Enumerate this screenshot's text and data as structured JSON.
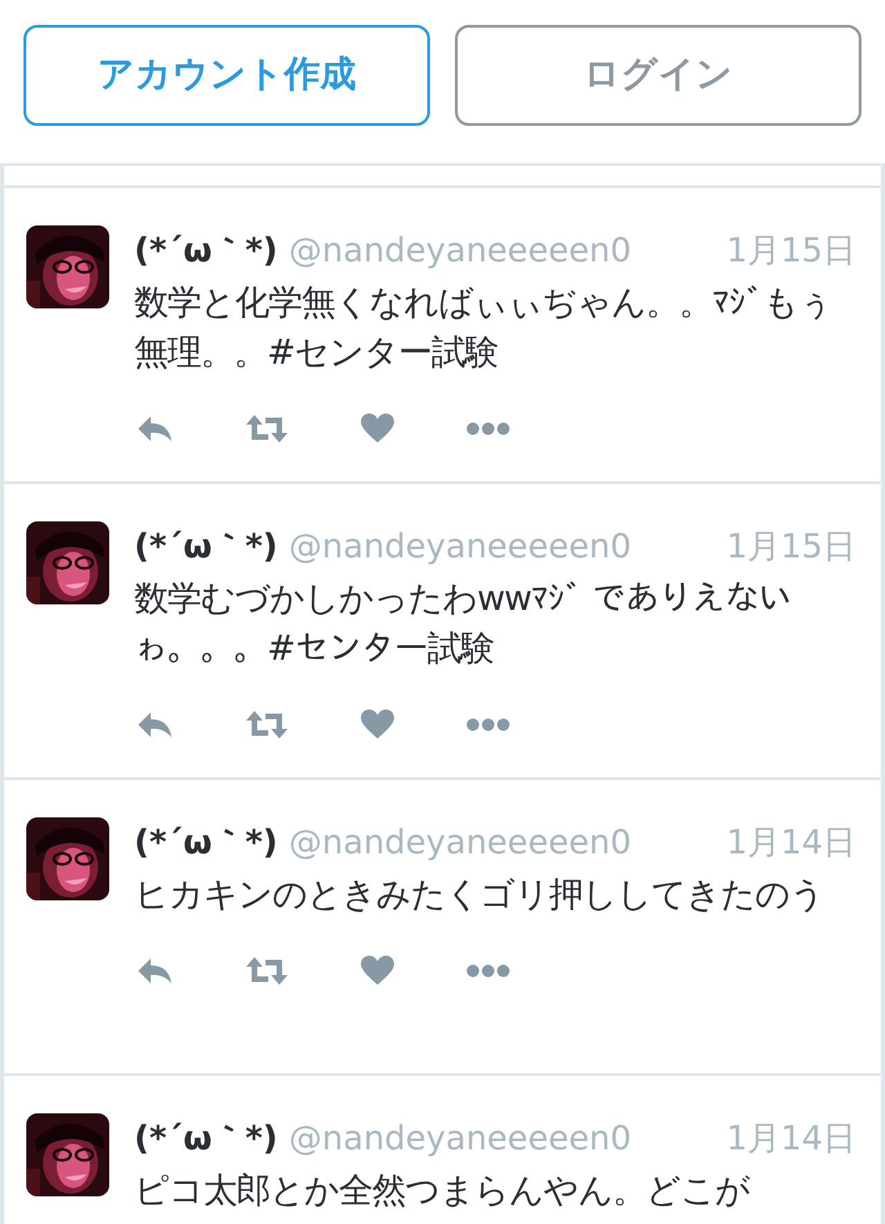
{
  "buttons": [
    {
      "label": "アカウント作成",
      "kind": "primary"
    },
    {
      "label": "ログイン",
      "kind": "secondary"
    }
  ],
  "tweets": [
    {
      "name": "(*´ω｀*)",
      "handle": "@nandeyaneeeeen0",
      "date": "1月15日",
      "text": "数学と化学無くなればぃぃぢゃん。。ﾏｼﾞもぅ無理。。#センター試験"
    },
    {
      "name": "(*´ω｀*)",
      "handle": "@nandeyaneeeeen0",
      "date": "1月15日",
      "text": "数学むづかしかったわwwﾏｼﾞ でありえないゎ。。。#センター試験"
    },
    {
      "name": "(*´ω｀*)",
      "handle": "@nandeyaneeeeen0",
      "date": "1月14日",
      "text": "ヒカキンのときみたくゴリ押ししてきたのう"
    },
    {
      "name": "(*´ω｀*)",
      "handle": "@nandeyaneeeeen0",
      "date": "1月14日",
      "text": "ピコ太郎とか全然つまらんやん。どこが"
    }
  ]
}
